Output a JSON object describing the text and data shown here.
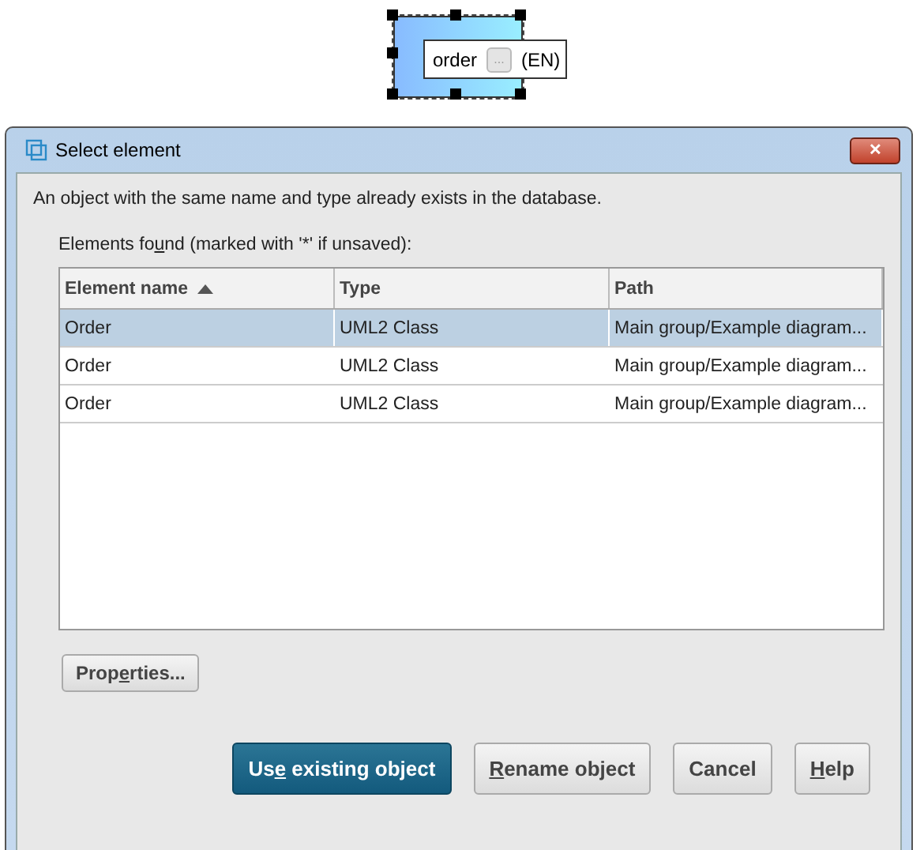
{
  "diagram": {
    "label": "order",
    "button": "...",
    "language": "(EN)",
    "selected": true
  },
  "window": {
    "title": "Select element",
    "close": "✕"
  },
  "message": "An object with the same name and type already exists in the database.",
  "list_label": {
    "before": "Elements fo",
    "key": "u",
    "after": "nd (marked with '*' if unsaved):"
  },
  "table": {
    "columns": [
      {
        "label": "Element name",
        "sorted": true
      },
      {
        "label": "Type",
        "sorted": false
      },
      {
        "label": "Path",
        "sorted": false
      }
    ],
    "rows": [
      {
        "cells": [
          "Order",
          "UML2 Class",
          "Main group/Example diagram..."
        ],
        "selected": true
      },
      {
        "cells": [
          "Order",
          "UML2 Class",
          "Main group/Example diagram..."
        ],
        "selected": false
      },
      {
        "cells": [
          "Order",
          "UML2 Class",
          "Main group/Example diagram..."
        ],
        "selected": false
      }
    ]
  },
  "properties_button": {
    "before": "Prop",
    "key": "e",
    "after": "rties..."
  },
  "buttons": [
    {
      "before": "Us",
      "key": "e",
      "after": " existing object",
      "default": true
    },
    {
      "key": "R",
      "after": "ename object",
      "default": false
    },
    {
      "before": "Cancel",
      "default": false
    },
    {
      "key": "H",
      "after": "elp",
      "default": false
    }
  ]
}
